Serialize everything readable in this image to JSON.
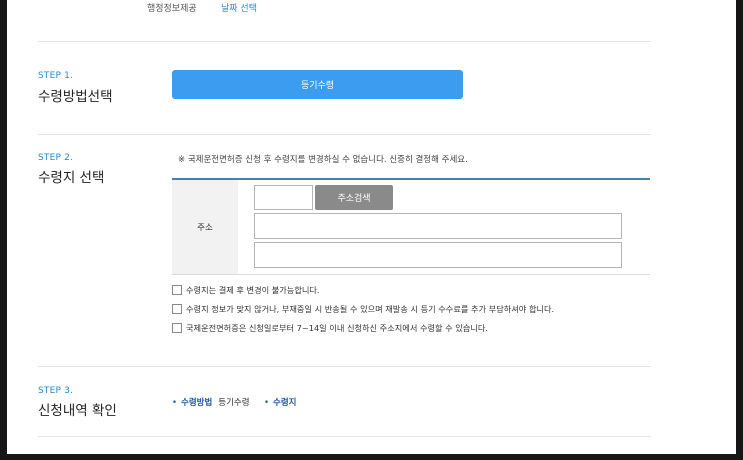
{
  "top": {
    "left_text": "행정정보제공",
    "right_link": "날짜 선택"
  },
  "step1": {
    "label": "STEP 1.",
    "title": "수령방법선택",
    "button": "등기수령"
  },
  "step2": {
    "label": "STEP 2.",
    "title": "수령지 선택",
    "notice": "※ 국제운전면허증 신청 후 수령지를 변경하실 수 없습니다. 신중히 결정해 주세요.",
    "address_header": "주소",
    "postcode_value": "",
    "address1_value": "",
    "address2_value": "",
    "search_button": "주소검색",
    "agreements": [
      "수령지는 결제 후 변경이 불가능합니다.",
      "수령지 정보가 맞지 않거나, 부재중일 시 반송될 수 있으며 재발송 시 등기 수수료를 추가 부담하셔야 합니다.",
      "국제운전면허증은 신청일로부터 7~14일 이내 신청하신 주소지에서 수령할 수 있습니다."
    ]
  },
  "step3": {
    "label": "STEP 3.",
    "title": "신청내역 확인",
    "method_key": "수령방법",
    "method_value": "등기수령",
    "address_key": "수령지",
    "address_value": ""
  }
}
